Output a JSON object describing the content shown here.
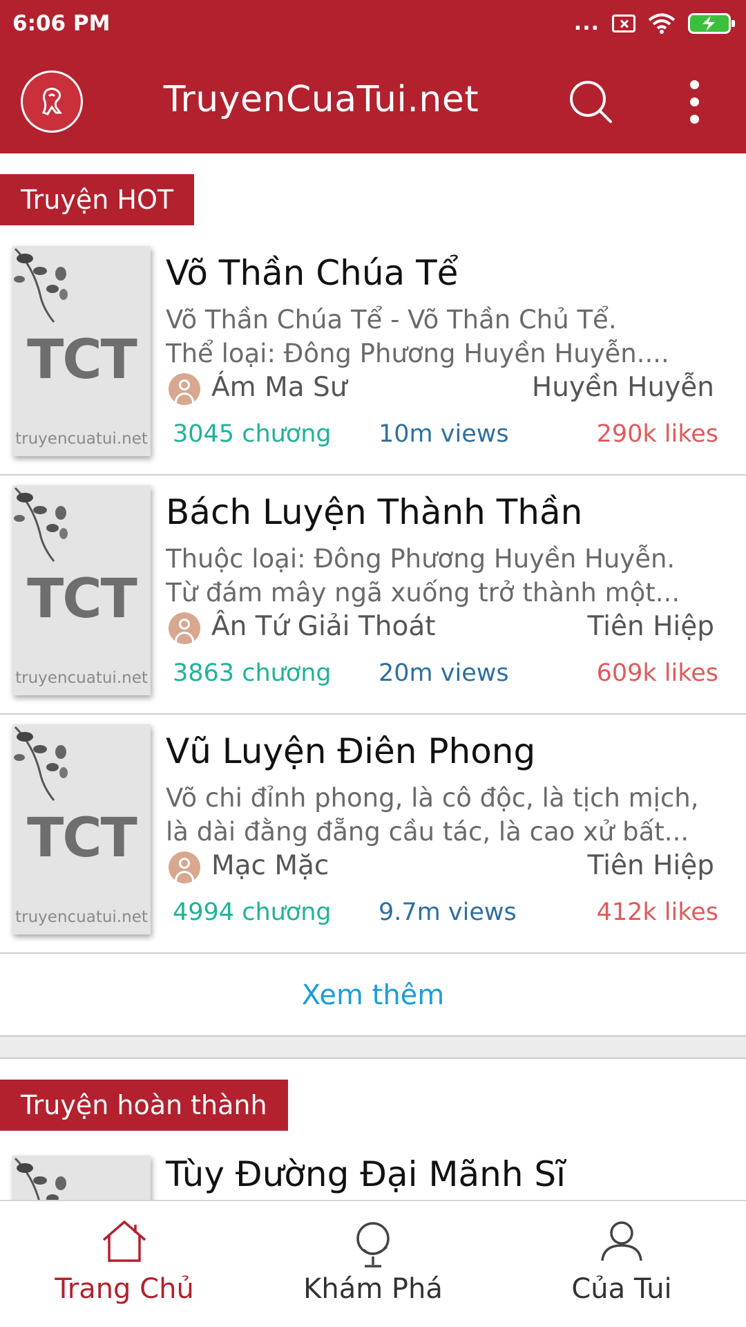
{
  "status_bar": {
    "time": "6:06 PM",
    "indicator": "..."
  },
  "app_bar": {
    "title": "TruyenCuaTui.net"
  },
  "hot_section": {
    "title": "Truyện HOT",
    "stories": [
      {
        "title": "Võ Thần Chúa Tể",
        "desc_line1": "Võ Thần Chúa Tể - Võ Thần Chủ Tể.",
        "desc_line2": "Thể loại: Đông Phương Huyền Huyễn....",
        "author": "Ám Ma Sư",
        "genre": "Huyền Huyễn",
        "chapters": "3045 chương",
        "views": "10m views",
        "likes": "290k likes",
        "cover_code": "TCT",
        "cover_site": "truyencuatui.net"
      },
      {
        "title": "Bách Luyện Thành Thần",
        "desc_line1": "Thuộc loại: Đông Phương Huyền Huyễn.",
        "desc_line2": "Từ đám mây ngã xuống trở thành một...",
        "author": "Ân Tứ Giải Thoát",
        "genre": "Tiên Hiệp",
        "chapters": "3863 chương",
        "views": "20m views",
        "likes": "609k likes",
        "cover_code": "TCT",
        "cover_site": "truyencuatui.net"
      },
      {
        "title": "Vũ Luyện Điên Phong",
        "desc_line1": "Võ chi đỉnh phong, là cô độc, là tịch mịch,",
        "desc_line2": "là dài đằng đẵng cầu tác, là cao xử bất...",
        "author": "Mạc Mặc",
        "genre": "Tiên Hiệp",
        "chapters": "4994 chương",
        "views": "9.7m views",
        "likes": "412k likes",
        "cover_code": "TCT",
        "cover_site": "truyencuatui.net"
      }
    ],
    "more_label": "Xem thêm"
  },
  "completed_section": {
    "title": "Truyện hoàn thành",
    "stories": [
      {
        "title": "Tùy Đường Đại Mãnh Sĩ"
      }
    ]
  },
  "bottom_nav": {
    "items": [
      {
        "label": "Trang Chủ",
        "icon": "home-icon",
        "active": true
      },
      {
        "label": "Khám Phá",
        "icon": "globe-icon",
        "active": false
      },
      {
        "label": "Của Tui",
        "icon": "user-icon",
        "active": false
      }
    ]
  },
  "colors": {
    "brand": "#b3212e",
    "chapters": "#1eb39a",
    "views": "#2d6f9e",
    "likes": "#e05a5a",
    "link": "#1a9ed9"
  }
}
